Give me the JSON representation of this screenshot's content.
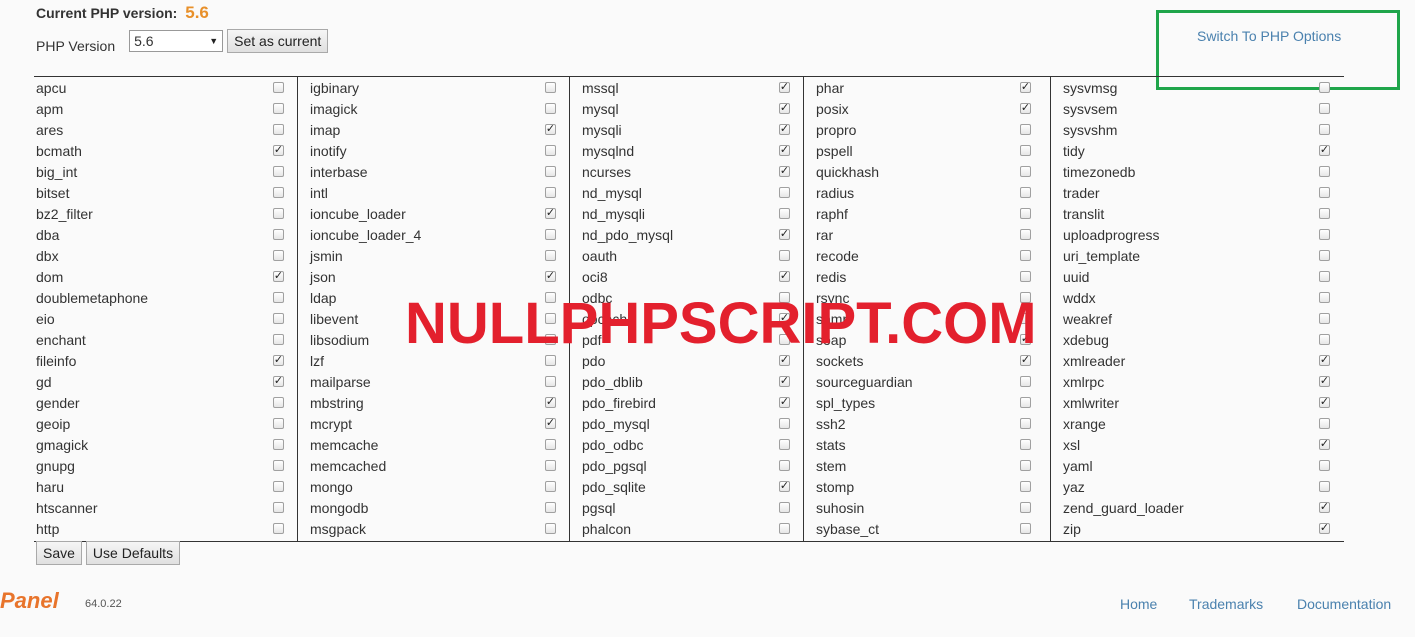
{
  "header": {
    "current_label": "Current PHP version:",
    "current_version": "5.6",
    "version_label": "PHP Version",
    "version_selected": "5.6",
    "set_current_label": "Set as current",
    "switch_link": "Switch To PHP Options"
  },
  "columns": [
    [
      {
        "name": "apcu",
        "checked": false
      },
      {
        "name": "apm",
        "checked": false
      },
      {
        "name": "ares",
        "checked": false
      },
      {
        "name": "bcmath",
        "checked": true
      },
      {
        "name": "big_int",
        "checked": false
      },
      {
        "name": "bitset",
        "checked": false
      },
      {
        "name": "bz2_filter",
        "checked": false
      },
      {
        "name": "dba",
        "checked": false
      },
      {
        "name": "dbx",
        "checked": false
      },
      {
        "name": "dom",
        "checked": true
      },
      {
        "name": "doublemetaphone",
        "checked": false
      },
      {
        "name": "eio",
        "checked": false
      },
      {
        "name": "enchant",
        "checked": false
      },
      {
        "name": "fileinfo",
        "checked": true
      },
      {
        "name": "gd",
        "checked": true
      },
      {
        "name": "gender",
        "checked": false
      },
      {
        "name": "geoip",
        "checked": false
      },
      {
        "name": "gmagick",
        "checked": false
      },
      {
        "name": "gnupg",
        "checked": false
      },
      {
        "name": "haru",
        "checked": false
      },
      {
        "name": "htscanner",
        "checked": false
      },
      {
        "name": "http",
        "checked": false
      }
    ],
    [
      {
        "name": "igbinary",
        "checked": false
      },
      {
        "name": "imagick",
        "checked": false
      },
      {
        "name": "imap",
        "checked": true
      },
      {
        "name": "inotify",
        "checked": false
      },
      {
        "name": "interbase",
        "checked": false
      },
      {
        "name": "intl",
        "checked": false
      },
      {
        "name": "ioncube_loader",
        "checked": true
      },
      {
        "name": "ioncube_loader_4",
        "checked": false
      },
      {
        "name": "jsmin",
        "checked": false
      },
      {
        "name": "json",
        "checked": true
      },
      {
        "name": "ldap",
        "checked": false
      },
      {
        "name": "libevent",
        "checked": false
      },
      {
        "name": "libsodium",
        "checked": false
      },
      {
        "name": "lzf",
        "checked": false
      },
      {
        "name": "mailparse",
        "checked": false
      },
      {
        "name": "mbstring",
        "checked": true
      },
      {
        "name": "mcrypt",
        "checked": true
      },
      {
        "name": "memcache",
        "checked": false
      },
      {
        "name": "memcached",
        "checked": false
      },
      {
        "name": "mongo",
        "checked": false
      },
      {
        "name": "mongodb",
        "checked": false
      },
      {
        "name": "msgpack",
        "checked": false
      }
    ],
    [
      {
        "name": "mssql",
        "checked": true
      },
      {
        "name": "mysql",
        "checked": true
      },
      {
        "name": "mysqli",
        "checked": true
      },
      {
        "name": "mysqlnd",
        "checked": true
      },
      {
        "name": "ncurses",
        "checked": true
      },
      {
        "name": "nd_mysql",
        "checked": false
      },
      {
        "name": "nd_mysqli",
        "checked": false
      },
      {
        "name": "nd_pdo_mysql",
        "checked": true
      },
      {
        "name": "oauth",
        "checked": false
      },
      {
        "name": "oci8",
        "checked": true
      },
      {
        "name": "odbc",
        "checked": false
      },
      {
        "name": "opcache",
        "checked": true
      },
      {
        "name": "pdf",
        "checked": false
      },
      {
        "name": "pdo",
        "checked": true
      },
      {
        "name": "pdo_dblib",
        "checked": true
      },
      {
        "name": "pdo_firebird",
        "checked": true
      },
      {
        "name": "pdo_mysql",
        "checked": false
      },
      {
        "name": "pdo_odbc",
        "checked": false
      },
      {
        "name": "pdo_pgsql",
        "checked": false
      },
      {
        "name": "pdo_sqlite",
        "checked": true
      },
      {
        "name": "pgsql",
        "checked": false
      },
      {
        "name": "phalcon",
        "checked": false
      }
    ],
    [
      {
        "name": "phar",
        "checked": true
      },
      {
        "name": "posix",
        "checked": true
      },
      {
        "name": "propro",
        "checked": false
      },
      {
        "name": "pspell",
        "checked": false
      },
      {
        "name": "quickhash",
        "checked": false
      },
      {
        "name": "radius",
        "checked": false
      },
      {
        "name": "raphf",
        "checked": false
      },
      {
        "name": "rar",
        "checked": false
      },
      {
        "name": "recode",
        "checked": false
      },
      {
        "name": "redis",
        "checked": false
      },
      {
        "name": "rsync",
        "checked": false
      },
      {
        "name": "snmp",
        "checked": false
      },
      {
        "name": "soap",
        "checked": true
      },
      {
        "name": "sockets",
        "checked": true
      },
      {
        "name": "sourceguardian",
        "checked": false
      },
      {
        "name": "spl_types",
        "checked": false
      },
      {
        "name": "ssh2",
        "checked": false
      },
      {
        "name": "stats",
        "checked": false
      },
      {
        "name": "stem",
        "checked": false
      },
      {
        "name": "stomp",
        "checked": false
      },
      {
        "name": "suhosin",
        "checked": false
      },
      {
        "name": "sybase_ct",
        "checked": false
      }
    ],
    [
      {
        "name": "sysvmsg",
        "checked": false
      },
      {
        "name": "sysvsem",
        "checked": false
      },
      {
        "name": "sysvshm",
        "checked": false
      },
      {
        "name": "tidy",
        "checked": true
      },
      {
        "name": "timezonedb",
        "checked": false
      },
      {
        "name": "trader",
        "checked": false
      },
      {
        "name": "translit",
        "checked": false
      },
      {
        "name": "uploadprogress",
        "checked": false
      },
      {
        "name": "uri_template",
        "checked": false
      },
      {
        "name": "uuid",
        "checked": false
      },
      {
        "name": "wddx",
        "checked": false
      },
      {
        "name": "weakref",
        "checked": false
      },
      {
        "name": "xdebug",
        "checked": false
      },
      {
        "name": "xmlreader",
        "checked": true
      },
      {
        "name": "xmlrpc",
        "checked": true
      },
      {
        "name": "xmlwriter",
        "checked": true
      },
      {
        "name": "xrange",
        "checked": false
      },
      {
        "name": "xsl",
        "checked": true
      },
      {
        "name": "yaml",
        "checked": false
      },
      {
        "name": "yaz",
        "checked": false
      },
      {
        "name": "zend_guard_loader",
        "checked": true
      },
      {
        "name": "zip",
        "checked": true
      }
    ]
  ],
  "actions": {
    "save_label": "Save",
    "defaults_label": "Use Defaults"
  },
  "watermark": "NULLPHPSCRIPT.COM",
  "footer": {
    "logo_text": "Panel",
    "version": "64.0.22",
    "links": [
      "Home",
      "Trademarks",
      "Documentation"
    ]
  },
  "colors": {
    "accent_version": "#e8902a",
    "link": "#4a81ae",
    "highlight_box": "#1fa54a",
    "watermark": "#e3202d"
  }
}
